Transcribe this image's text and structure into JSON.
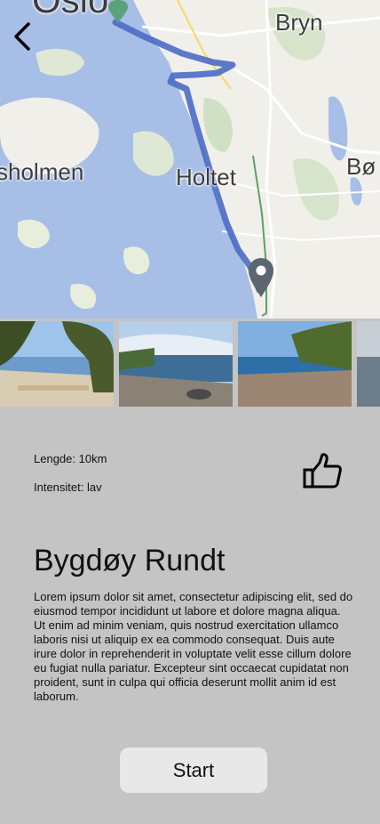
{
  "map": {
    "labels": {
      "oslo": "Oslo",
      "bryn": "Bryn",
      "holmen": "sholmen",
      "hoeyet": "Holtet",
      "boe": "Bø"
    }
  },
  "info": {
    "length": "Lengde: 10km",
    "intensity": "Intensitet: lav"
  },
  "route": {
    "title": "Bygdøy Rundt",
    "description": "Lorem ipsum dolor sit amet, consectetur adipiscing elit, sed do eiusmod tempor incididunt ut labore et dolore magna aliqua. Ut enim ad minim veniam, quis nostrud exercitation ullamco laboris nisi ut aliquip ex ea commodo consequat. Duis aute irure dolor in reprehenderit in voluptate velit esse cillum dolore eu fugiat nulla pariatur. Excepteur sint occaecat cupidatat non proident, sunt in culpa qui officia deserunt mollit anim id est laborum."
  },
  "actions": {
    "start_label": "Start"
  },
  "icons": {
    "back": "back-arrow-icon",
    "like": "thumbs-up-icon",
    "pin": "map-pin-icon"
  },
  "colors": {
    "background": "#c4c4c4",
    "route": "#4a6bc4",
    "water": "#a8bfe6",
    "button": "#e8e8e8"
  }
}
